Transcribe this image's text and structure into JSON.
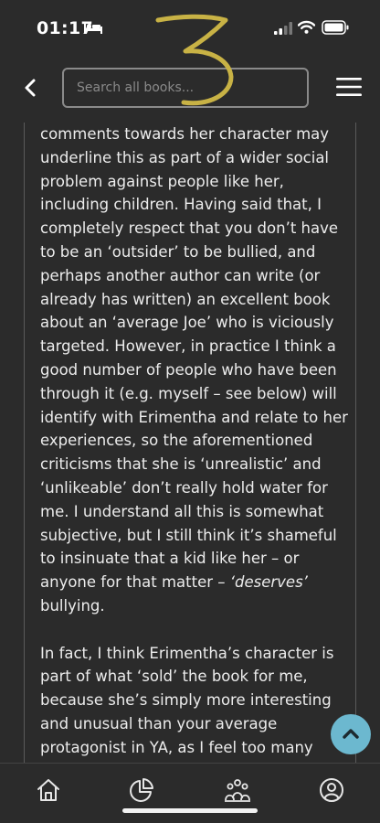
{
  "status_bar": {
    "time": "01:17",
    "icons": [
      "bed-icon",
      "signal-icon",
      "wifi-icon",
      "battery-icon"
    ]
  },
  "header": {
    "back_icon": "chevron-left-icon",
    "search_placeholder": "Search all books...",
    "menu_icon": "hamburger-menu-icon"
  },
  "review": {
    "paragraph_1_before": "comments towards her character may underline this as part of a wider social problem against people like her, including children. Having said that, I completely respect that you don’t have to be an ‘outsider’ to be bullied, and perhaps another author can write (or already has written) an excellent book about an ‘average Joe’ who is viciously targeted. However, in practice I think a good number of people who have been through it (e.g. myself – see below) will identify with Erimentha and relate to her experiences, so the aforementioned criticisms that she is ‘unrealistic’ and ‘unlikeable’ don’t really hold water for me. I understand all this is somewhat subjective, but I still think it’s shameful to insinuate that a kid like her – or anyone for that matter – ",
    "paragraph_1_emphasis": "‘deserves’",
    "paragraph_1_after": " bullying.",
    "paragraph_2": "In fact, I think Erimentha’s character is part of what ‘sold’ the book for me, because she’s simply more interesting and unusual than your average protagonist in YA, as I feel too many"
  },
  "scroll_top_icon": "chevron-up-icon",
  "bottom_nav": {
    "items": [
      "home-icon",
      "pie-chart-icon",
      "community-icon",
      "profile-icon"
    ]
  },
  "colors": {
    "background": "#2b2b2b",
    "text": "#ececec",
    "search_border": "#8a8a8a",
    "accent": "#6cb8cf",
    "handwritten_annotation": "#c8b245"
  }
}
